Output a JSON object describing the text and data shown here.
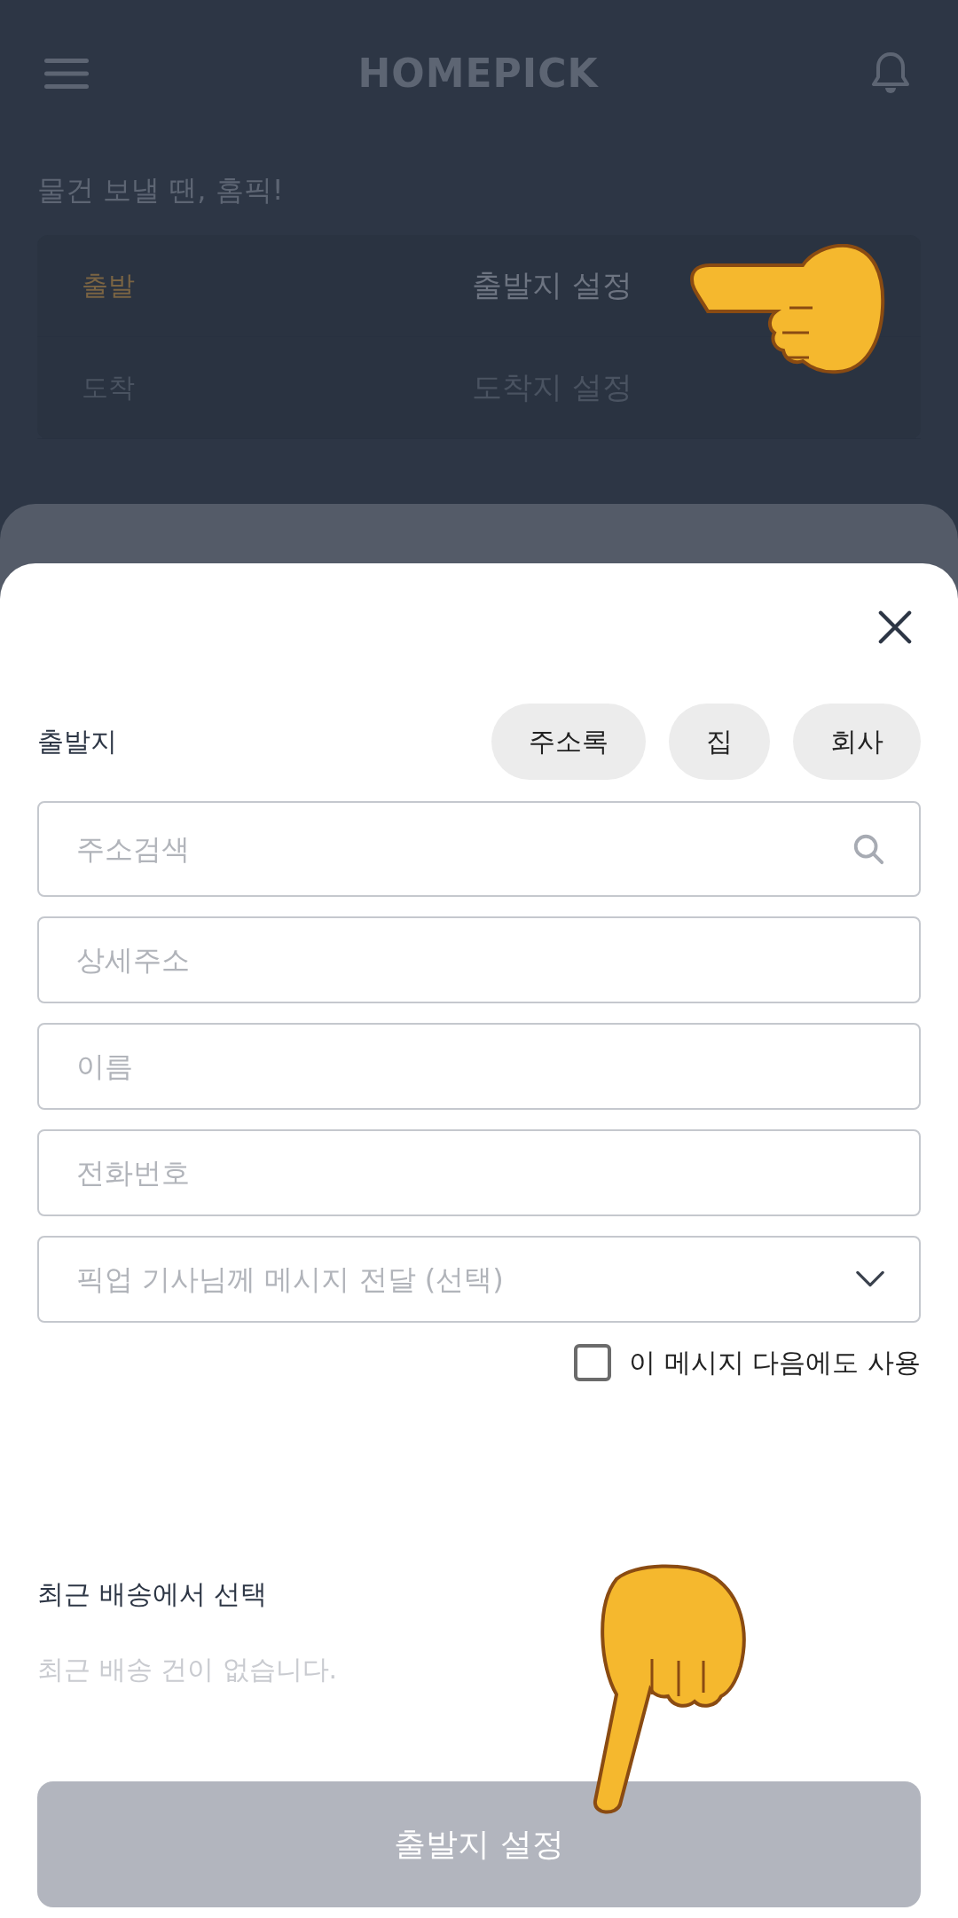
{
  "header": {
    "logo": "HOMEPICK"
  },
  "tagline": "물건 보낼 땐, 홈픽!",
  "route": [
    {
      "label": "출발",
      "value": "출발지 설정",
      "selected": true
    },
    {
      "label": "도착",
      "value": "도착지 설정",
      "selected": false
    }
  ],
  "sheet": {
    "title": "출발지",
    "chips": [
      "주소록",
      "집",
      "회사"
    ],
    "fields": [
      {
        "kind": "search",
        "placeholder": "주소검색"
      },
      {
        "kind": "text",
        "placeholder": "상세주소"
      },
      {
        "kind": "text",
        "placeholder": "이름"
      },
      {
        "kind": "text",
        "placeholder": "전화번호"
      },
      {
        "kind": "select",
        "placeholder": "픽업 기사님께 메시지 전달 (선택)"
      }
    ],
    "remember": {
      "label": "이 메시지 다음에도 사용",
      "checked": false
    },
    "recent": {
      "title": "최근 배송에서 선택",
      "empty": "최근 배송 건이 없습니다."
    },
    "submit": {
      "label": "출발지 설정",
      "disabled": true
    }
  }
}
